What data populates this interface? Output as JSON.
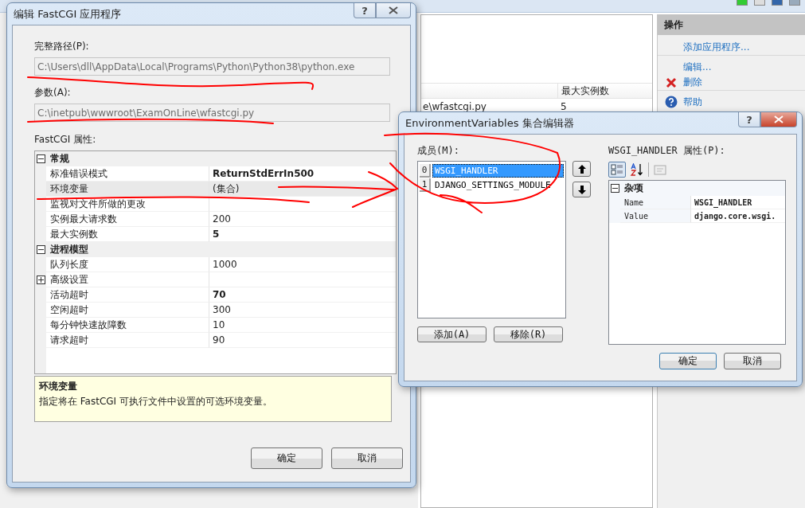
{
  "main_window": {
    "table": {
      "column_2": "最大实例数",
      "rows": [
        {
          "column_1": "e\\wfastcgi.py",
          "column_2": "5"
        }
      ]
    },
    "actions": {
      "title": "操作",
      "items": [
        {
          "label": "添加应用程序...",
          "kind": "plain",
          "divider_after": true
        },
        {
          "label": "编辑...",
          "kind": "plain",
          "divider_after": false
        },
        {
          "label": "删除",
          "kind": "delete",
          "divider_after": true
        },
        {
          "label": "帮助",
          "kind": "help",
          "divider_after": false
        }
      ]
    }
  },
  "edit_dialog": {
    "title": "编辑 FastCGI 应用程序",
    "help_button": "?",
    "path_label": "完整路径(P):",
    "path_value": "C:\\Users\\dll\\AppData\\Local\\Programs\\Python\\Python38\\python.exe",
    "path_disabled": true,
    "args_label": "参数(A):",
    "args_value": "C:\\inetpub\\wwwroot\\ExamOnLine\\wfastcgi.py",
    "args_disabled": true,
    "grid_label": "FastCGI 属性:",
    "categories": [
      {
        "label": "常规",
        "expanded": true,
        "rows": [
          {
            "kind": "property",
            "name": "标准错误模式",
            "value": "ReturnStdErrIn500",
            "modified": true,
            "selected": false
          },
          {
            "kind": "property",
            "name": "环境变量",
            "value": "(集合)",
            "modified": false,
            "selected": true
          },
          {
            "kind": "property",
            "name": "监视对文件所做的更改",
            "modified": false,
            "selected": false
          },
          {
            "kind": "property",
            "name": "实例最大请求数",
            "value": "200",
            "modified": false,
            "selected": false
          },
          {
            "kind": "property",
            "name": "最大实例数",
            "value": "5",
            "modified": true,
            "selected": false
          }
        ]
      },
      {
        "label": "进程模型",
        "expanded": true,
        "rows": [
          {
            "kind": "property",
            "name": "队列长度",
            "value": "1000",
            "modified": false,
            "selected": false
          },
          {
            "kind": "group",
            "name": "高级设置",
            "expanded": false,
            "selected": false
          },
          {
            "kind": "property",
            "name": "活动超时",
            "value": "70",
            "modified": true,
            "selected": false
          },
          {
            "kind": "property",
            "name": "空闲超时",
            "value": "300",
            "modified": false,
            "selected": false
          },
          {
            "kind": "property",
            "name": "每分钟快速故障数",
            "value": "10",
            "modified": false,
            "selected": false
          },
          {
            "kind": "property",
            "name": "请求超时",
            "value": "90",
            "modified": false,
            "selected": false
          }
        ]
      }
    ],
    "description": {
      "title": "环境变量",
      "text": "指定将在 FastCGI 可执行文件中设置的可选环境变量。"
    },
    "buttons": [
      "确定",
      "取消"
    ]
  },
  "env_dialog": {
    "title": "EnvironmentVariables 集合编辑器",
    "help_button": "?",
    "members_label": "成员(M):",
    "members": [
      {
        "index": "0",
        "name": "WSGI_HANDLER",
        "selected": true
      },
      {
        "index": "1",
        "name": "DJANGO_SETTINGS_MODULE",
        "selected": false
      }
    ],
    "add_button": "添加(A)",
    "remove_button": "移除(R)",
    "props_label": "WSGI_HANDLER 属性(P):",
    "category": {
      "label": "杂项",
      "expanded": true,
      "rows": [
        {
          "name": "Name",
          "value": "WSGI_HANDLER"
        },
        {
          "name": "Value",
          "value": "django.core.wsgi."
        }
      ]
    },
    "buttons": [
      "确定",
      "取消"
    ]
  }
}
